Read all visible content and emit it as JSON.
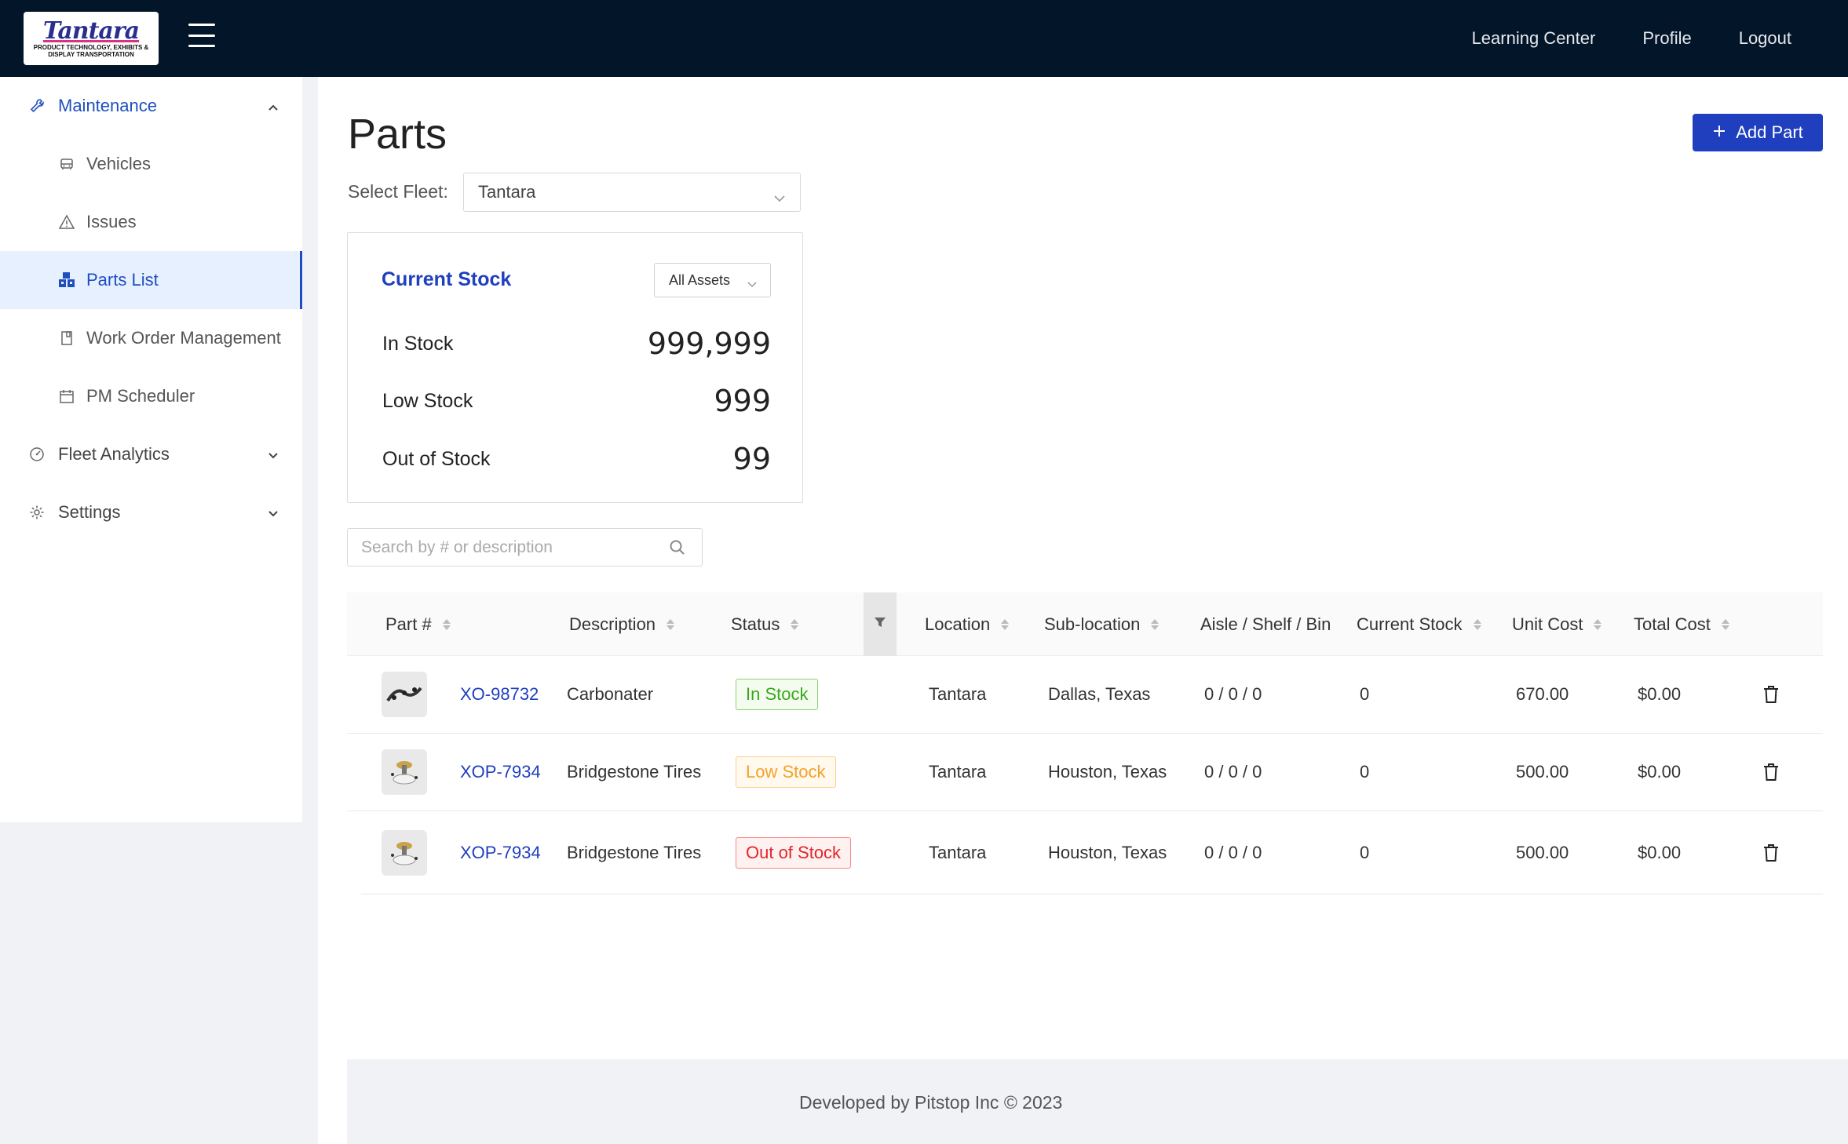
{
  "topbar": {
    "logo_text": "Tantara",
    "logo_tagline": "PRODUCT TECHNOLOGY, EXHIBITS & DISPLAY TRANSPORTATION",
    "links": [
      "Learning Center",
      "Profile",
      "Logout"
    ],
    "colors": {
      "background": "#031528"
    }
  },
  "sidebar": {
    "maintenance": {
      "label": "Maintenance",
      "icon": "wrench-icon",
      "expanded": true
    },
    "items": [
      {
        "label": "Vehicles",
        "icon": "car-icon"
      },
      {
        "label": "Issues",
        "icon": "warning-icon"
      },
      {
        "label": "Parts List",
        "icon": "parts-icon",
        "active": true
      },
      {
        "label": "Work Order Management",
        "icon": "clipboard-icon"
      },
      {
        "label": "PM Scheduler",
        "icon": "calendar-icon"
      }
    ],
    "fleet_analytics": {
      "label": "Fleet Analytics",
      "icon": "dashboard-icon"
    },
    "settings": {
      "label": "Settings",
      "icon": "gear-icon"
    }
  },
  "page": {
    "title": "Parts",
    "add_button": "Add Part",
    "fleet_label": "Select Fleet:",
    "fleet_value": "Tantara"
  },
  "stock": {
    "title": "Current Stock",
    "filter": "All Assets",
    "rows": [
      {
        "label": "In Stock",
        "value": "999,999"
      },
      {
        "label": "Low Stock",
        "value": "999"
      },
      {
        "label": "Out of Stock",
        "value": "99"
      }
    ]
  },
  "search": {
    "placeholder": "Search by # or description",
    "value": ""
  },
  "table": {
    "columns": [
      "Part #",
      "Description",
      "Status",
      "Location",
      "Sub-location",
      "Aisle / Shelf / Bin",
      "Current Stock",
      "Unit Cost",
      "Total Cost"
    ],
    "rows": [
      {
        "part": "XO-98732",
        "description": "Carbonater",
        "status": "In Stock",
        "status_type": "in",
        "location": "Tantara",
        "sublocation": "Dallas, Texas",
        "asb": "0 / 0 / 0",
        "current_stock": "0",
        "unit_cost": "670.00",
        "total_cost": "$0.00"
      },
      {
        "part": "XOP-7934",
        "description": "Bridgestone Tires",
        "status": "Low Stock",
        "status_type": "low",
        "location": "Tantara",
        "sublocation": "Houston, Texas",
        "asb": "0 / 0 / 0",
        "current_stock": "0",
        "unit_cost": "500.00",
        "total_cost": "$0.00"
      },
      {
        "part": "XOP-7934",
        "description": "Bridgestone Tires",
        "status": "Out of Stock",
        "status_type": "out",
        "location": "Tantara",
        "sublocation": "Houston, Texas",
        "asb": "0 / 0 / 0",
        "current_stock": "0",
        "unit_cost": "500.00",
        "total_cost": "$0.00"
      }
    ]
  },
  "footer": {
    "text": "Developed by Pitstop Inc © 2023"
  },
  "colors": {
    "primary": "#1f3fbf",
    "in_stock": "#3aa81c",
    "low_stock": "#f5a12a",
    "out_of_stock": "#e1262d"
  }
}
